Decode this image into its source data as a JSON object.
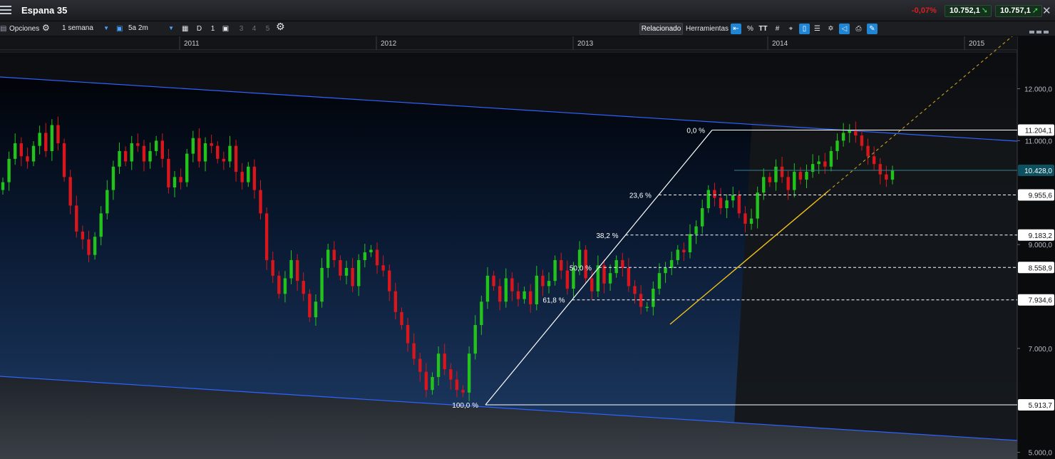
{
  "window": {
    "title": "Espana 35",
    "change_pct": "-0,07%",
    "sell_price": "10.752,1",
    "buy_price": "10.757,1"
  },
  "toolbar": {
    "options_label": "Opciones",
    "period_select": "1 semana",
    "range_select": "5a 2m",
    "d_label": "D",
    "one_label": "1",
    "layout_labels": [
      "3",
      "4",
      "5"
    ],
    "related_label": "Relacionado",
    "tools_label": "Herramientas",
    "percent_label": "%",
    "text_tool_label": "TT"
  },
  "colors": {
    "up_candle": "#22c41c",
    "down_candle": "#d8161b",
    "channel_line": "#2f63ff",
    "fib_line": "#ffffff",
    "trend_line": "#f2c21a",
    "current_price_bg": "#0d5060",
    "accent": "#1f86d6"
  },
  "chart_data": {
    "type": "candlestick",
    "x_axis": {
      "labels": [
        "2011",
        "2012",
        "2013",
        "2014",
        "2015"
      ]
    },
    "y_axis": {
      "labels": [
        "12.000,0",
        "11.000,0",
        "9.000,0",
        "7.000,0",
        "5.000,0"
      ],
      "ylim": [
        5000,
        12500
      ]
    },
    "price_labels": [
      {
        "value": 11204.1,
        "label": "11.204,1"
      },
      {
        "value": 10428.0,
        "label": "10.428,0",
        "current": true
      },
      {
        "value": 9955.6,
        "label": "9.955,6"
      },
      {
        "value": 9183.2,
        "label": "9.183,2"
      },
      {
        "value": 8558.9,
        "label": "8.558,9"
      },
      {
        "value": 7934.6,
        "label": "7.934,6"
      },
      {
        "value": 5913.7,
        "label": "5.913,7"
      }
    ],
    "fibonacci": {
      "high": 11204.1,
      "low": 5913.7,
      "levels": [
        {
          "label": "0,0 %",
          "value": 11204.1
        },
        {
          "label": "23,6 %",
          "value": 9955.6
        },
        {
          "label": "38,2 %",
          "value": 9183.2
        },
        {
          "label": "50,0 %",
          "value": 8558.9
        },
        {
          "label": "61,8 %",
          "value": 7934.6
        },
        {
          "label": "100,0 %",
          "value": 5913.7
        }
      ]
    },
    "series": [
      {
        "values": [
          10200,
          10650,
          10950,
          10700,
          10600,
          10900,
          11150,
          10800,
          11300,
          10950,
          10300,
          9750,
          9250,
          9100,
          8800,
          9150,
          9600,
          10050,
          10500,
          10800,
          10600,
          10950,
          10900,
          10600,
          10800,
          11000,
          10650,
          10100,
          10300,
          10200,
          10750,
          11050,
          10600,
          10950,
          10900,
          10650,
          10600,
          10900,
          10400,
          10200,
          10500,
          10050,
          9600,
          8700,
          8400,
          8050,
          8350,
          8700,
          8300,
          8050,
          7600,
          7900,
          8550,
          8900,
          8700,
          8400,
          8550,
          8200,
          8700,
          8850,
          8900,
          8600,
          8500,
          8100,
          7700,
          7450,
          7100,
          6800,
          6550,
          6200,
          6450,
          6900,
          6600,
          6400,
          6200,
          6150,
          6900,
          7450,
          7900,
          8400,
          8200,
          7900,
          8350,
          8100,
          7950,
          8100,
          7850,
          8400,
          8200,
          8300,
          8700,
          8500,
          8150,
          8550,
          8900,
          8350,
          8100,
          8600,
          8250,
          8450,
          8700,
          8550,
          8200,
          8050,
          7800,
          7800,
          8150,
          8450,
          8550,
          8700,
          8900,
          8850,
          9200,
          9350,
          9700,
          10050,
          9900,
          9700,
          9850,
          9950,
          9600,
          9400,
          9500,
          10000,
          10300,
          10200,
          10500,
          10300,
          10050,
          10400,
          10250,
          10400,
          10550,
          10600,
          10500,
          10800,
          11000,
          11150,
          11204,
          11100,
          10900,
          10700,
          10550,
          10350,
          10250,
          10428
        ]
      }
    ],
    "channel": {
      "upper": [
        11800,
        11050
      ],
      "lower": [
        6200,
        5400
      ]
    },
    "trendline": {
      "start": 7700,
      "end": 10250,
      "projection_end": 12950
    }
  }
}
